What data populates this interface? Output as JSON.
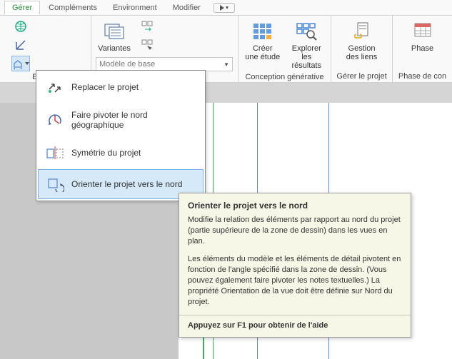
{
  "tabs": {
    "active": "Gérer",
    "items": [
      "Gérer",
      "Compléments",
      "Environment",
      "Modifier"
    ]
  },
  "ribbon": {
    "emplac_label": "Emplac",
    "variantes_label": "Variantes",
    "model_combo": "Modèle de base",
    "creer_label1": "Créer",
    "creer_label2": "une étude",
    "explorer_label1": "Explorer",
    "explorer_label2": "les résultats",
    "conception_label": "Conception générative",
    "gestion_label1": "Gestion",
    "gestion_label2": "des liens",
    "gerer_label": "Gérer le projet",
    "phase_label": "Phase",
    "phase_panel": "Phase de con"
  },
  "menu": {
    "items": [
      "Replacer le projet",
      "Faire pivoter le nord géographique",
      "Symétrie du projet",
      "Orienter le projet vers le nord"
    ]
  },
  "tooltip": {
    "title": "Orienter le projet vers le nord",
    "body1": "Modifie la relation des éléments par rapport au nord du projet (partie supérieure de la zone de dessin) dans les vues en plan.",
    "body2": "Les éléments du modèle et les éléments de détail pivotent en fonction de l'angle spécifié dans la zone de dessin. (Vous pouvez également faire pivoter les notes textuelles.) La propriété Orientation de la vue doit être définie sur Nord du projet.",
    "help": "Appuyez sur F1 pour obtenir de l'aide"
  }
}
